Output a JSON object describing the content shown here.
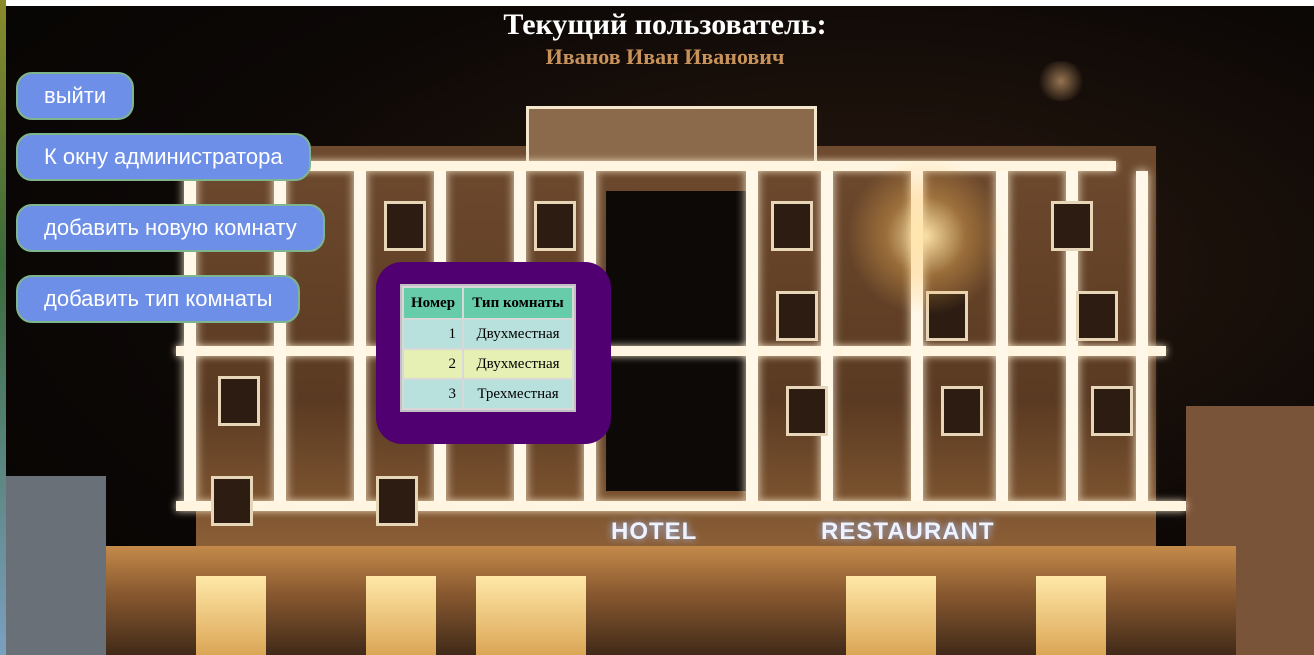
{
  "header": {
    "title": "Текущий пользователь:",
    "user_name": "Иванов Иван Иванович"
  },
  "buttons": {
    "logout": "выйти",
    "admin_window": "К окну администратора",
    "add_room": "добавить новую комнату",
    "add_room_type": "добавить тип комнаты"
  },
  "rooms_table": {
    "headers": [
      "Номер",
      "Тип комнаты"
    ],
    "rows": [
      {
        "number": "1",
        "type": "Двухместная"
      },
      {
        "number": "2",
        "type": "Двухместная"
      },
      {
        "number": "3",
        "type": "Трехместная"
      }
    ]
  },
  "background": {
    "sign_left": "HOTEL",
    "sign_right": "RESTAURANT"
  },
  "colors": {
    "button_bg": "#6d8fe8",
    "button_border": "#7fb58c",
    "panel_bg": "#500070",
    "table_header": "#66ccaa",
    "row_odd": "#b8e0dc",
    "row_even": "#e6f0b4",
    "user_name": "#c8925a"
  }
}
